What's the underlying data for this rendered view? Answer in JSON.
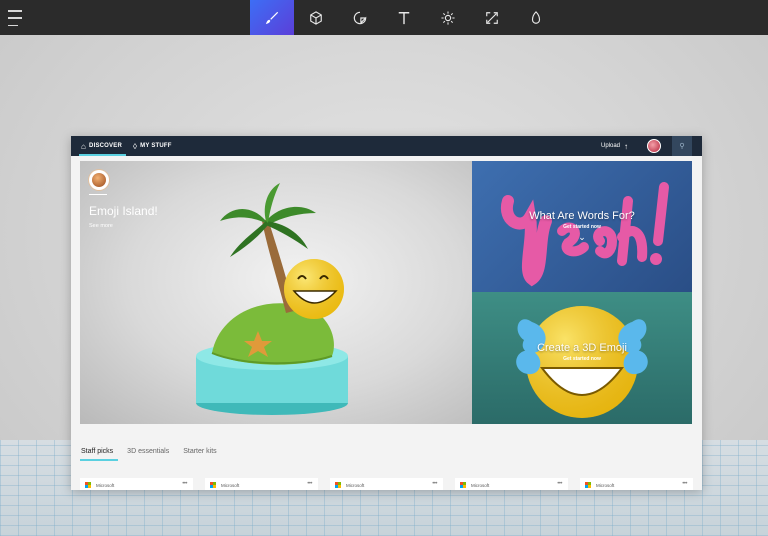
{
  "toolbar": {
    "tools": [
      {
        "icon": "brush-icon",
        "active": true
      },
      {
        "icon": "cube-icon",
        "active": false
      },
      {
        "icon": "sticker-icon",
        "active": false
      },
      {
        "icon": "text-icon",
        "active": false
      },
      {
        "icon": "effects-icon",
        "active": false
      },
      {
        "icon": "canvas-icon",
        "active": false
      },
      {
        "icon": "remix3d-icon",
        "active": false
      }
    ],
    "accent": "#3d6ef5"
  },
  "remix": {
    "nav": {
      "discover": "DISCOVER",
      "my_stuff": "MY STUFF",
      "upload": "Upload"
    },
    "hero": {
      "title": "Emoji Island!",
      "subtitle": "See more"
    },
    "tiles": [
      {
        "title": "What Are Words For?",
        "cta": "Get started now"
      },
      {
        "title": "Create a 3D Emoji",
        "cta": "Get started now"
      }
    ],
    "tabs": [
      "Staff picks",
      "3D essentials",
      "Starter kits"
    ],
    "cards": [
      {
        "publisher": "Microsoft"
      },
      {
        "publisher": "Microsoft"
      },
      {
        "publisher": "Microsoft"
      },
      {
        "publisher": "Microsoft"
      },
      {
        "publisher": "Microsoft"
      }
    ]
  }
}
